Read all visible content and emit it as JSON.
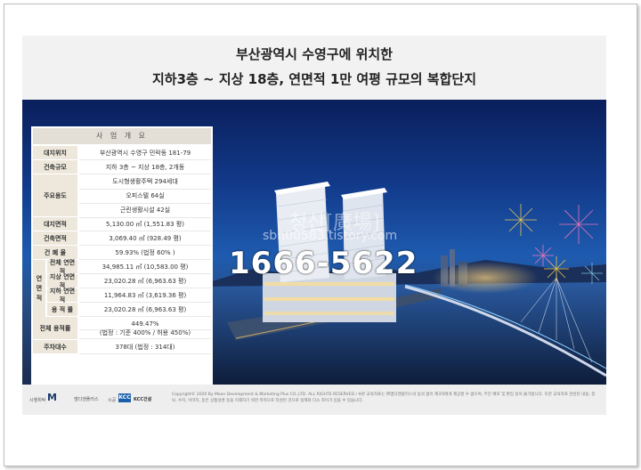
{
  "header": {
    "line1": "부산광역시 수영구에 위치한",
    "line2": "지하3층 ~ 지상 18층, 연면적 1만 여평 규모의 복합단지"
  },
  "table": {
    "caption": "사 업 개 요",
    "rows": [
      {
        "key": "대지위치",
        "value": "부산광역시 수영구 민락동 181-79"
      },
      {
        "key": "건축규모",
        "value": "지하 3층 ~ 지상 18층, 2개동"
      },
      {
        "key": "주요용도",
        "values": [
          "도시형생활주택 294세대",
          "오피스텔 64실",
          "근린생활시설 42실"
        ]
      },
      {
        "key": "대지면적",
        "value": "5,130.00 ㎡ (1,551.83 평)"
      },
      {
        "key": "건축면적",
        "value": "3,069.40 ㎡ (928.49 평)"
      },
      {
        "key": "건 폐 율",
        "value": "59.93% (법정 60% )"
      },
      {
        "key": "전체 연면적",
        "value": "34,985.11 ㎡ (10,583.00 평)"
      },
      {
        "key": "지상 연면적",
        "value": "23,020.28 ㎡ (6,963.63 평)"
      },
      {
        "key": "지하 연면적",
        "value": "11,964.83 ㎡ (3,619.36 평)"
      },
      {
        "key": "용 적 률",
        "value": "23,020.28 ㎡ (6,963.63 평)"
      },
      {
        "key": "전체 용적률",
        "value": "449.47%",
        "value2": "(법정 : 기준 400% / 허용 450%)"
      },
      {
        "key": "주차대수",
        "value": "378대 (법정 : 314대)"
      }
    ],
    "side_label": [
      "연",
      "면",
      "적"
    ]
  },
  "overlay": {
    "phone": "1666-5622",
    "watermark_name": "청산[廣場]",
    "watermark_url": "sbn00583.tistory.com"
  },
  "footer": {
    "developer_label": "시행위탁",
    "developer_logo": "M",
    "developer_name": "엠디앤플러스",
    "builder_label": "시공",
    "builder_logo": "KCC",
    "builder_name": "KCC건설",
    "copyright": "Copyright© 2020 By Moon Development & Marketing Plus CO.,LTD. ALL RIGHTS RESERVED / ※본 교육자료는 ㈜엠디앤플러스의 동의 없이 제3자에게 제공할 수 없으며, 무단 배포 및 편집 등이 불가합니다. 또한 교육자료 관련된 내용, 정보, 수치, 이미지, 등은 상품설명 등을 이해하기 위한 목적으로 작성된 것으로 실제와 다소 차이가 있을 수 있습니다."
  },
  "colors": {
    "header_bg": "#f2f2f2",
    "sky_top": "#0a1f5c",
    "table_key_bg": "#eee8dc",
    "footer_bg": "#eeeeee"
  }
}
